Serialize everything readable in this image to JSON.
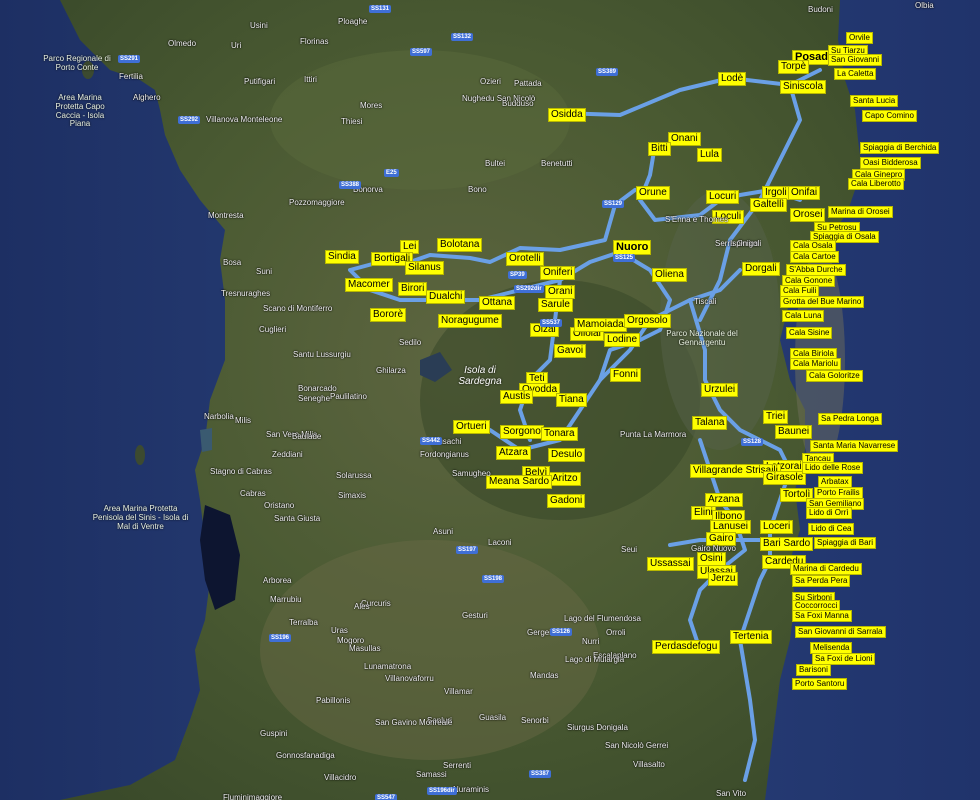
{
  "towns": [
    "Posada",
    "Torpè",
    "Siniscola",
    "Lodè",
    "Osidda",
    "Onani",
    "Bitti",
    "Lula",
    "Orune",
    "Locuri",
    "Irgoli",
    "Onifai",
    "Galtellì",
    "Orosei",
    "Loculi",
    "Nuoro",
    "Orotelli",
    "Oniferi",
    "Oliena",
    "Dorgali",
    "Lei",
    "Bolotana",
    "Sindia",
    "Bortigali",
    "Silanus",
    "Macomer",
    "Birori",
    "Dualchi",
    "Ottana",
    "Bolotana",
    "Bororè",
    "Noragugume",
    "Orani",
    "Sarule",
    "Olzai",
    "Ollolai",
    "Mamoiada",
    "Orgosolo",
    "Lodine",
    "Gavoi",
    "Fonni",
    "Teti",
    "Ovodda",
    "Austis",
    "Tiana",
    "Ortueri",
    "Sorgono",
    "Tonara",
    "Atzara",
    "Desulo",
    "Belvì",
    "Aritzo",
    "Meana Sardo",
    "Gadoni",
    "Urzulei",
    "Talana",
    "Triei",
    "Baunei",
    "Lotzorai",
    "Villagrande Strisaili",
    "Girasole",
    "Tortolì",
    "Arzana",
    "Elini",
    "Ilbono",
    "Lanusei",
    "Loceri",
    "Gairo",
    "Bari Sardo",
    "Osini",
    "Ussassai",
    "Ulassai",
    "Cardedu",
    "Jerzu",
    "Tertenia",
    "Perdasdefogu"
  ],
  "beaches": [
    "Orvile",
    "Su Tiarzu",
    "San Giovanni",
    "La Caletta",
    "Santa Lucia",
    "Capo Comino",
    "Spiaggia di Berchida",
    "Oasi Bidderosa",
    "Cala Ginepro",
    "Cala Liberotto",
    "Marina di Orosei",
    "Su Petrosu",
    "Spiaggia di Osala",
    "Cala Osala",
    "Cala Cartoe",
    "S'Abba Durche",
    "Cala Gonone",
    "Cala Fuili",
    "Grotta del Bue Marino",
    "Cala Luna",
    "Cala Sisine",
    "Cala Biriola",
    "Cala Mariolu",
    "Cala Goloritze",
    "Sa Pedra Longa",
    "Santa Maria Navarrese",
    "Tancau",
    "Lido delle Rose",
    "Arbatax",
    "Porto Frailis",
    "San Gemiliano",
    "Lido di Orrì",
    "Lido di Cea",
    "Spiaggia di Bari",
    "Marina di Cardedu",
    "Sa Perda Pera",
    "Su Sirboni",
    "Coccorrocci",
    "Sa Foxi Manna",
    "San Giovanni di Sarrala",
    "Melisenda",
    "Sa Foxi de Lioni",
    "Barisoni",
    "Porto Santoru"
  ],
  "places": [
    "Budoni",
    "Olbia",
    "Ploaghe",
    "Usini",
    "Florinas",
    "Ittiri",
    "Olmedo",
    "Uri",
    "Fertilia",
    "Alghero",
    "Putifigari",
    "Mores",
    "Ozieri",
    "Pattada",
    "Nughedu San Nicolò",
    "Budduso",
    "Thiesi",
    "Villanova Monteleone",
    "Bultei",
    "Benetutti",
    "Bono",
    "Bonorva",
    "Pozzomaggiore",
    "Montresta",
    "Bosa",
    "Suni",
    "Tresnuraghes",
    "Scano di Montiferro",
    "Cuglieri",
    "Santu Lussurgiu",
    "Bonarcado",
    "Seneghe",
    "Paulilatino",
    "Ghilarza",
    "Sedilo",
    "Narbolia",
    "Milis",
    "San Vero Milis",
    "Baulade",
    "Zeddiani",
    "Busachi",
    "Fordongianus",
    "Samugheo",
    "Solarussa",
    "Simaxis",
    "Cabras",
    "Oristano",
    "Santa Giusta",
    "Arborea",
    "Marrubiu",
    "Terralba",
    "Uras",
    "Mogoro",
    "Masullas",
    "Curcuris",
    "Ales",
    "Asuni",
    "Laconi",
    "Gesturi",
    "Gergei",
    "Nurri",
    "Orroli",
    "Seui",
    "Escalaplano",
    "Mandas",
    "Villamar",
    "Lunamatrona",
    "Villanovaforru",
    "Pabillonis",
    "Sanluri",
    "San Gavino Monreale",
    "Guspini",
    "Gonnosfanadiga",
    "Villacidro",
    "Samassi",
    "Serrenti",
    "Guasila",
    "Senorbì",
    "Siurgus Donigala",
    "Nuraminis",
    "San Nicolò Gerrei",
    "Villasalto",
    "Fluminimaggiore",
    "San Vito",
    "Punta La Marmora",
    "Tiscali",
    "Serra Orrios",
    "Ispinigoli",
    "S'Enna e Thomes",
    "Stagno di Cabras",
    "Gairo Nuovo",
    "Lago del Flumendosa",
    "Lago di Mulargia"
  ],
  "parks": [
    "Parco Regionale di Porto Conte",
    "Area Marina Protetta Capo Caccia - Isola Piana",
    "Area Marina Protetta Penisola del Sinis - Isola di Mal di Ventre",
    "Parco Nazionale del Gennargentu"
  ],
  "regions": [
    "Isola di Sardegna"
  ],
  "roads": [
    "SS131",
    "SS291",
    "SS597",
    "SS132",
    "SS389",
    "SS292",
    "E25",
    "SS129",
    "SS125",
    "SS128",
    "SS537",
    "SP39",
    "SS292dir",
    "SS388",
    "SS442",
    "SS197",
    "SS198",
    "SS126",
    "SS196",
    "SS547",
    "SS387",
    "SS196dir"
  ],
  "colors": {
    "sea": "#24376b",
    "land": "#4d5a34",
    "route": "#6aa0e6",
    "label_bg": "#ffff00"
  }
}
